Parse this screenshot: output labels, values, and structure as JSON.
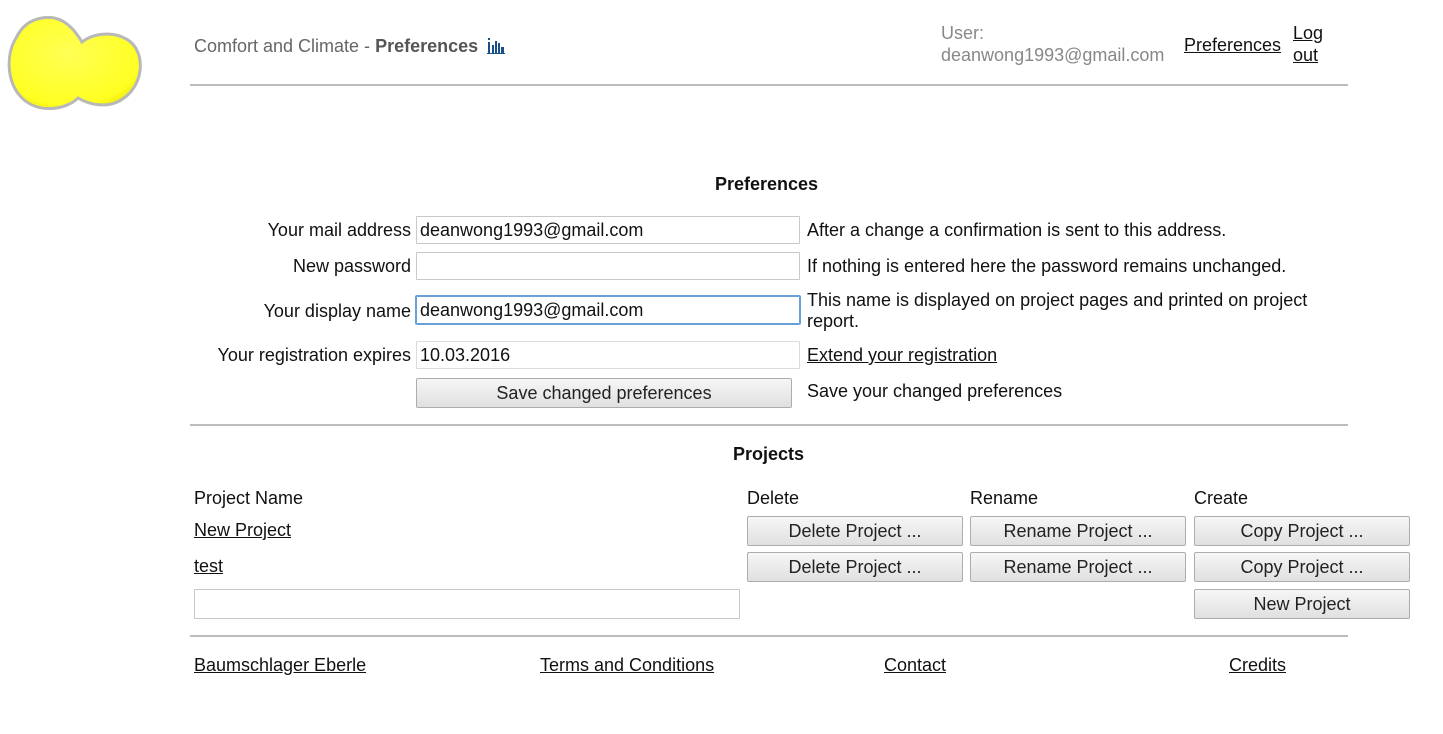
{
  "header": {
    "app_name": "Comfort and Climate - ",
    "page_name": "Preferences",
    "user_label": "User:",
    "user_email": "deanwong1993@gmail.com",
    "preferences_link": "Preferences",
    "logout_link": "Log out"
  },
  "preferences": {
    "title": "Preferences",
    "mail_label": "Your mail address",
    "mail_value": "deanwong1993@gmail.com",
    "mail_hint": "After a change a confirmation is sent to this address.",
    "password_label": "New password",
    "password_value": "",
    "password_hint": "If nothing is entered here the password remains unchanged.",
    "display_label": "Your display name",
    "display_value": "deanwong1993@gmail.com",
    "display_hint": "This name is displayed on project pages and printed on project report.",
    "expires_label": "Your registration expires",
    "expires_value": "10.03.2016",
    "extend_link": "Extend your registration",
    "save_button": "Save changed preferences",
    "save_hint": "Save your changed preferences"
  },
  "projects": {
    "title": "Projects",
    "col_name": "Project Name",
    "col_delete": "Delete",
    "col_rename": "Rename",
    "col_create": "Create",
    "rows": [
      {
        "name": "New Project",
        "delete": "Delete Project ...",
        "rename": "Rename Project ...",
        "copy": "Copy Project ..."
      },
      {
        "name": "test",
        "delete": "Delete Project ...",
        "rename": "Rename Project ...",
        "copy": "Copy Project ..."
      }
    ],
    "new_project_value": "",
    "new_project_button": "New Project"
  },
  "footer": {
    "links": [
      "Baumschlager Eberle",
      "Terms and Conditions",
      "Contact",
      "Credits"
    ]
  },
  "colors": {
    "logo_fill": "#ffff2e",
    "focus_border": "#6a9fd8",
    "info_icon": "#1a4f8a"
  }
}
